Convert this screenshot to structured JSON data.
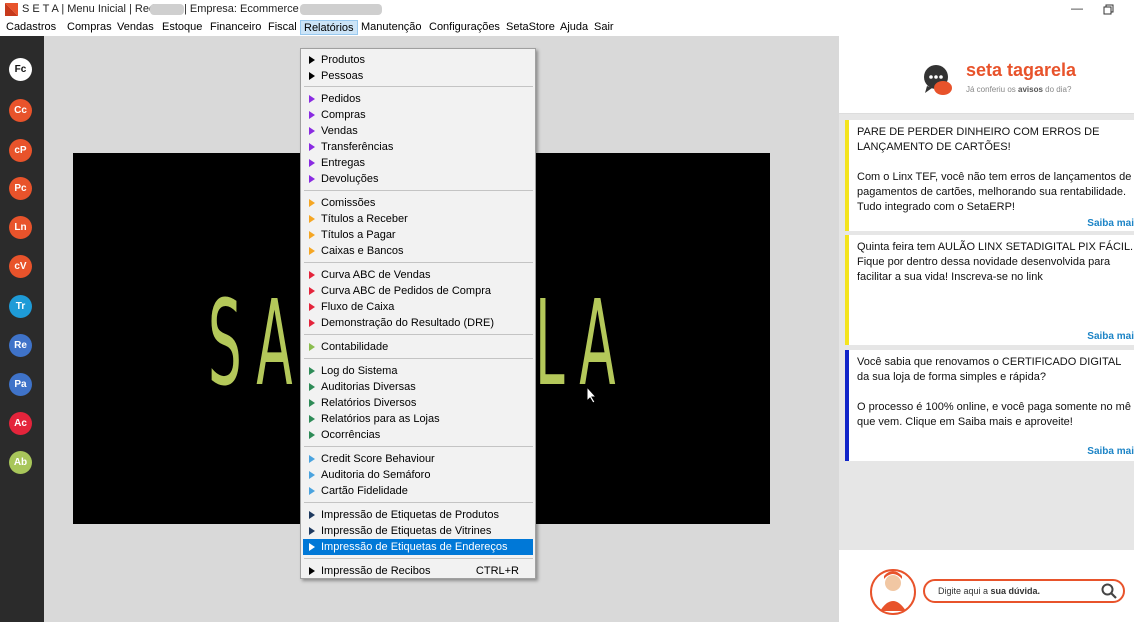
{
  "window": {
    "title_part1": "S E T A | Menu Inicial | Rede: ",
    "title_part2": "| Empresa: Ecommerce SI",
    "minimize_icon": "minimize-icon",
    "restore_icon": "restore-icon"
  },
  "menubar": {
    "items": [
      "Cadastros",
      "Compras",
      "Vendas",
      "Estoque",
      "Financeiro",
      "Fiscal",
      "Relatórios",
      "Manutenção",
      "Configurações",
      "SetaStore",
      "Ajuda",
      "Sair"
    ],
    "active": "Relatórios"
  },
  "sidebar": {
    "shortcuts": [
      {
        "label": "Fc",
        "color": "#ffffff"
      },
      {
        "label": "Cc",
        "color": "#e8532b"
      },
      {
        "label": "cP",
        "color": "#e8532b"
      },
      {
        "label": "Pc",
        "color": "#e8532b"
      },
      {
        "label": "Ln",
        "color": "#e8532b"
      },
      {
        "label": "cV",
        "color": "#e8532b"
      },
      {
        "label": "Tr",
        "color": "#1e9bd7"
      },
      {
        "label": "Re",
        "color": "#3f73c9"
      },
      {
        "label": "Pa",
        "color": "#3f73c9"
      },
      {
        "label": "Ac",
        "color": "#e4243b"
      },
      {
        "label": "Ab",
        "color": "#a8c65a"
      }
    ]
  },
  "banner": {
    "text_left": "SAI",
    "text_right": "LA"
  },
  "relatorios_menu": {
    "items": [
      {
        "label": "Produtos",
        "arrow": "#000000"
      },
      {
        "label": "Pessoas",
        "arrow": "#000000"
      },
      {
        "label": "Pedidos",
        "arrow": "#8a2be2"
      },
      {
        "label": "Compras",
        "arrow": "#8a2be2"
      },
      {
        "label": "Vendas",
        "arrow": "#8a2be2"
      },
      {
        "label": "Transferências",
        "arrow": "#8a2be2"
      },
      {
        "label": "Entregas",
        "arrow": "#8a2be2"
      },
      {
        "label": "Devoluções",
        "arrow": "#8a2be2"
      },
      {
        "label": "Comissões",
        "arrow": "#f5a623"
      },
      {
        "label": "Títulos a Receber",
        "arrow": "#f5a623"
      },
      {
        "label": "Títulos a Pagar",
        "arrow": "#f5a623"
      },
      {
        "label": "Caixas e Bancos",
        "arrow": "#f5a623"
      },
      {
        "label": "Curva ABC de Vendas",
        "arrow": "#e4243b"
      },
      {
        "label": "Curva ABC de Pedidos de Compra",
        "arrow": "#e4243b"
      },
      {
        "label": "Fluxo de Caixa",
        "arrow": "#e4243b"
      },
      {
        "label": "Demonstração do Resultado (DRE)",
        "arrow": "#e4243b"
      },
      {
        "label": "Contabilidade",
        "arrow": "#8bbd4f"
      },
      {
        "label": "Log do Sistema",
        "arrow": "#2e8b57"
      },
      {
        "label": "Auditorias Diversas",
        "arrow": "#2e8b57"
      },
      {
        "label": "Relatórios Diversos",
        "arrow": "#2e8b57"
      },
      {
        "label": "Relatórios para as Lojas",
        "arrow": "#2e8b57"
      },
      {
        "label": "Ocorrências",
        "arrow": "#2e8b57"
      },
      {
        "label": "Credit Score Behaviour",
        "arrow": "#4aa3df"
      },
      {
        "label": "Auditoria do Semáforo",
        "arrow": "#4aa3df"
      },
      {
        "label": "Cartão Fidelidade",
        "arrow": "#4aa3df"
      },
      {
        "label": "Impressão de Etiquetas de Produtos",
        "arrow": "#1f3a5f"
      },
      {
        "label": "Impressão de Etiquetas de Vitrines",
        "arrow": "#1f3a5f"
      },
      {
        "label": "Impressão de Etiquetas de Endereços",
        "arrow": "#1f3a5f",
        "highlighted": true
      },
      {
        "label": "Impressão de Recibos",
        "arrow": "#000000",
        "shortcut": "CTRL+R"
      }
    ]
  },
  "tagarela": {
    "title": "seta tagarela",
    "subtitle_pre": "Já conferiu os ",
    "subtitle_bold": "avisos",
    "subtitle_post": " do dia?",
    "cards": [
      {
        "text": "PARE DE PERDER DINHEIRO COM ERROS DE LANÇAMENTO DE CARTÕES!\n\nCom o Linx TEF, você não tem erros de lançamentos de pagamentos de cartões, melhorando sua rentabilidade. Tudo integrado com o SetaERP!",
        "more": "Saiba mai",
        "accent": "#f4e41d"
      },
      {
        "text": "Quinta feira tem AULÃO LINX SETADIGITAL PIX FÁCIL. Fique por dentro dessa novidade desenvolvida para facilitar a sua vida! Inscreva-se no link",
        "more": "Saiba mai",
        "accent": "#f4e41d"
      },
      {
        "text": "Você sabia que renovamos o CERTIFICADO DIGITAL da sua loja de forma simples e rápida?\n\nO processo é 100% online, e você paga somente no mê que vem. Clique em Saiba mais e aproveite!",
        "more": "Saiba mai",
        "accent": "#1024c8"
      }
    ],
    "search_placeholder_pre": "Digite aqui a ",
    "search_placeholder_bold": "sua dúvida."
  }
}
